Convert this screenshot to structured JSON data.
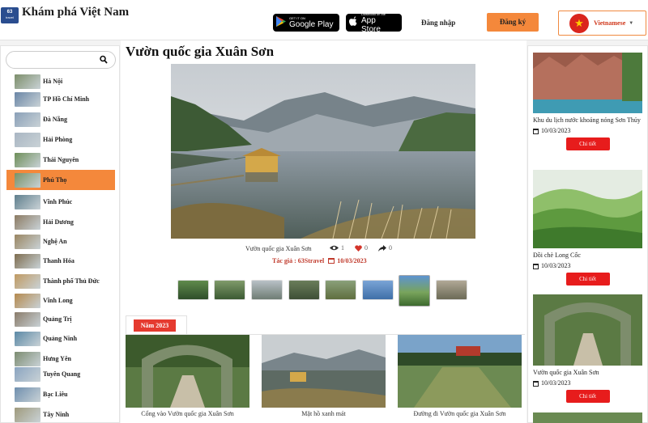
{
  "header": {
    "logo_text": "63",
    "logo_sub": "travel",
    "site_title": "Khám phá Việt Nam",
    "google_play": {
      "small": "GET IT ON",
      "big": "Google Play"
    },
    "app_store": {
      "small": "Download on the",
      "big": "App Store"
    },
    "login_label": "Đăng nhập",
    "register_label": "Đăng ký",
    "language": "Vietnamese",
    "flag_star": "★"
  },
  "search": {
    "placeholder": "",
    "icon": "search-icon"
  },
  "provinces": [
    {
      "name": "Hà Nội",
      "color": "#7d8f6b"
    },
    {
      "name": "TP Hồ Chí Minh",
      "color": "#6a86a6"
    },
    {
      "name": "Đà Nẵng",
      "color": "#8aa0b8"
    },
    {
      "name": "Hải Phòng",
      "color": "#a9b6c3"
    },
    {
      "name": "Thái Nguyên",
      "color": "#6e8f59"
    },
    {
      "name": "Phú Thọ",
      "color": "#789268"
    },
    {
      "name": "Vĩnh Phúc",
      "color": "#5f7f8d"
    },
    {
      "name": "Hải Dương",
      "color": "#8c7b63"
    },
    {
      "name": "Nghệ An",
      "color": "#9a8662"
    },
    {
      "name": "Thanh Hóa",
      "color": "#7e6d4f"
    },
    {
      "name": "Thành phố Thủ Đức",
      "color": "#c09a62"
    },
    {
      "name": "Vĩnh Long",
      "color": "#b58a4e"
    },
    {
      "name": "Quảng Trị",
      "color": "#8a7c6a"
    },
    {
      "name": "Quảng Ninh",
      "color": "#5b89a6"
    },
    {
      "name": "Hưng Yên",
      "color": "#7c8c71"
    },
    {
      "name": "Tuyên Quang",
      "color": "#8aa4c0"
    },
    {
      "name": "Bạc Liêu",
      "color": "#6f8fae"
    },
    {
      "name": "Tây Ninh",
      "color": "#9f9a7c"
    },
    {
      "name": "",
      "color": "#7a8f6d"
    }
  ],
  "active_province_index": 5,
  "main": {
    "title": "Vườn quốc gia Xuân Sơn",
    "photo_caption": "Vườn quốc gia Xuân Sơn",
    "views": "1",
    "likes": "0",
    "shares": "0",
    "author_line": "Tác giả : 63Stravel",
    "date": "10/03/2023",
    "year_tab": "Năm 2023",
    "gallery": [
      {
        "caption": "Cổng vào Vườn quốc gia Xuân Sơn"
      },
      {
        "caption": "Mặt hồ xanh mát"
      },
      {
        "caption": "Đường đi Vườn quốc gia Xuân Sơn"
      }
    ]
  },
  "news": [
    {
      "title": "Khu du lịch nước khoáng nóng Sơn Thủy",
      "date": "10/03/2023",
      "button": "Chi tiết"
    },
    {
      "title": "Đồi chè Long Cốc",
      "date": "10/03/2023",
      "button": "Chi tiết"
    },
    {
      "title": "Vườn quốc gia Xuân Sơn",
      "date": "10/03/2023",
      "button": "Chi tiết"
    }
  ],
  "colors": {
    "accent": "#f4883b",
    "detail_button": "#e71c1c",
    "year_badge": "#e53a2f",
    "author": "#c0392b"
  }
}
